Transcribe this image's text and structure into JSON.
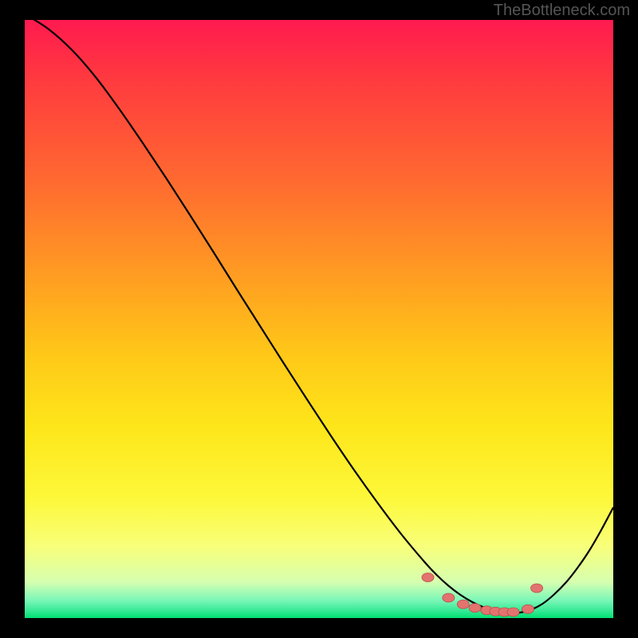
{
  "watermark": "TheBottleneck.com",
  "colors": {
    "background": "#000000",
    "marker_fill": "#e3736f",
    "marker_stroke": "#bb4e48",
    "curve": "#000000"
  },
  "chart_data": {
    "type": "line",
    "title": "",
    "xlabel": "",
    "ylabel": "",
    "xlim": [
      0,
      100
    ],
    "ylim": [
      0,
      100
    ],
    "curve": {
      "x": [
        0,
        4,
        8,
        12,
        16,
        20,
        24,
        28,
        32,
        36,
        40,
        44,
        48,
        52,
        56,
        60,
        64,
        68,
        70,
        72,
        74,
        76,
        78,
        80,
        82,
        84,
        86,
        88,
        90,
        92,
        94,
        96,
        98,
        100
      ],
      "y": [
        101,
        98.5,
        95,
        90.5,
        85.2,
        79.5,
        73.6,
        67.5,
        61.3,
        55,
        48.8,
        42.6,
        36.5,
        30.5,
        24.7,
        19.2,
        14.0,
        9.3,
        7.2,
        5.4,
        3.9,
        2.7,
        1.8,
        1.2,
        0.9,
        0.9,
        1.4,
        2.4,
        4.0,
        6.0,
        8.5,
        11.4,
        14.8,
        18.5
      ]
    },
    "markers": [
      {
        "x": 68.5,
        "y": 6.8
      },
      {
        "x": 72.0,
        "y": 3.4
      },
      {
        "x": 74.5,
        "y": 2.3
      },
      {
        "x": 76.5,
        "y": 1.7
      },
      {
        "x": 78.5,
        "y": 1.3
      },
      {
        "x": 80.0,
        "y": 1.1
      },
      {
        "x": 81.5,
        "y": 1.0
      },
      {
        "x": 83.0,
        "y": 1.0
      },
      {
        "x": 85.5,
        "y": 1.5
      },
      {
        "x": 87.0,
        "y": 5.0
      }
    ]
  }
}
